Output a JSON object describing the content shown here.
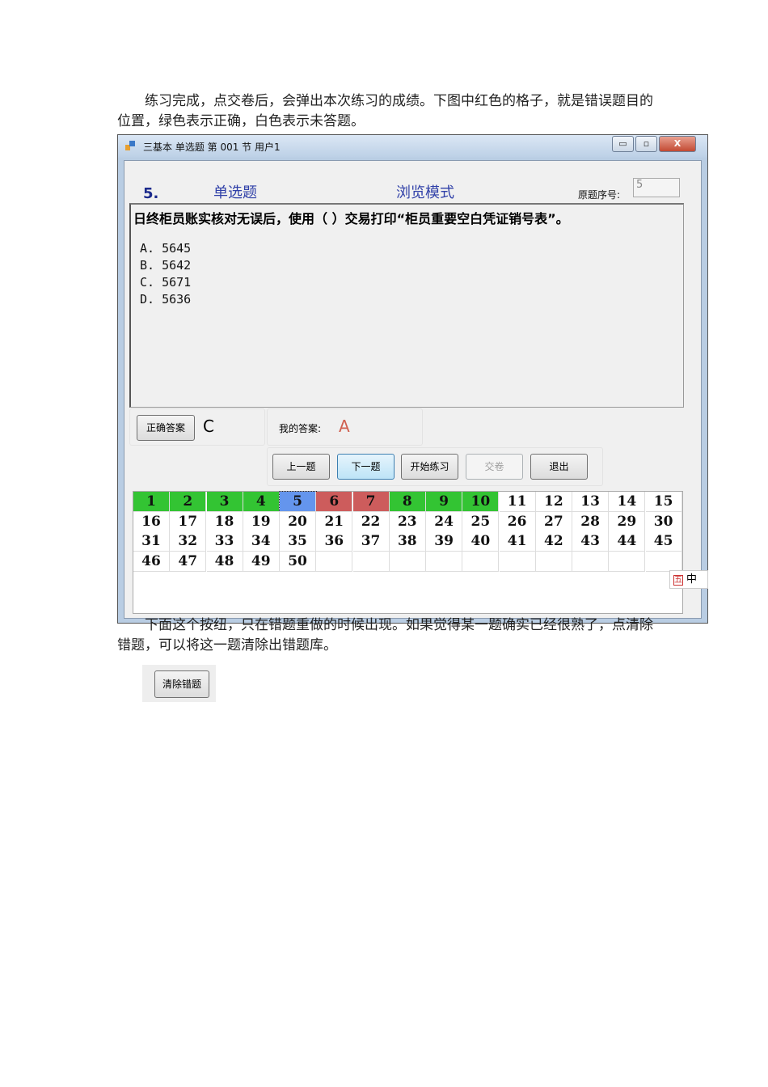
{
  "intro_text": "练习完成，点交卷后，会弹出本次练习的成绩。下图中红色的格子，就是错误题目的位置，绿色表示正确，白色表示未答题。",
  "window": {
    "title": "三基本 单选题 第 001 节 用户1",
    "min": "▭",
    "max": "▫",
    "close": "X"
  },
  "question": {
    "number": "5.",
    "type": "单选题",
    "mode": "浏览模式",
    "orig_label": "原题序号:",
    "orig_value": "5",
    "text": "日终柜员账实核对无误后，使用（ ）交易打印“柜员重要空白凭证销号表”。",
    "options": [
      "A. 5645",
      "B. 5642",
      "C. 5671",
      "D. 5636"
    ]
  },
  "answer": {
    "correct_button": "正确答案",
    "correct_value": "C",
    "my_label": "我的答案:",
    "my_value": "A"
  },
  "buttons": {
    "prev": "上一题",
    "next": "下一题",
    "start": "开始练习",
    "submit": "交卷",
    "exit": "退出"
  },
  "grid": {
    "total": 50,
    "columns": 15,
    "statuses": {
      "1": "correct",
      "2": "correct",
      "3": "correct",
      "4": "correct",
      "5": "current",
      "6": "wrong",
      "7": "wrong",
      "8": "correct",
      "9": "correct",
      "10": "correct"
    },
    "colors": {
      "correct": "#33c433",
      "wrong": "#cd5c5c",
      "current": "#6495ed",
      "unanswered": "#ffffff"
    }
  },
  "ime": {
    "label": "中",
    "icon": "五"
  },
  "outro_text": "下面这个按纽，只在错题重做的时候出现。如果觉得某一题确实已经很熟了，点清除错题，可以将这一题清除出错题库。",
  "clear_button": "清除错题"
}
